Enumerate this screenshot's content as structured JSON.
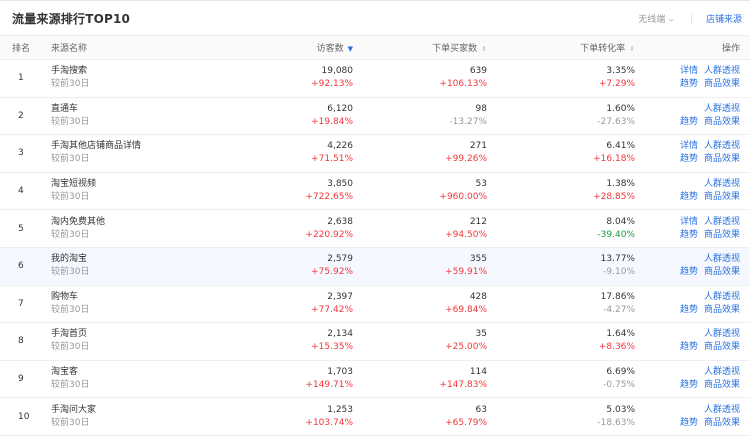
{
  "header": {
    "title": "流量来源排行TOP10",
    "wireless_label": "无线端",
    "shop_source_link": "店铺来源"
  },
  "columns": {
    "rank": "排名",
    "source_name": "来源名称",
    "visitors": "访客数",
    "buyers": "下单买家数",
    "conversion": "下单转化率",
    "operation": "操作"
  },
  "compare_label": "较前30日",
  "action_labels": {
    "detail": "详情",
    "crowd": "人群透视",
    "trend": "趋势",
    "product": "商品效果"
  },
  "colors": {
    "link": "#2b73e0",
    "increase": "#f2363a",
    "highlight_decrease": "#1a9c3a"
  },
  "rows": [
    {
      "rank": "1",
      "name": "手淘搜索",
      "visitors": "19,080",
      "visitors_change": "+92.13%",
      "buyers": "639",
      "buyers_change": "+106.13%",
      "conv": "3.35%",
      "conv_change": "+7.29%",
      "has_detail": true
    },
    {
      "rank": "2",
      "name": "直通车",
      "visitors": "6,120",
      "visitors_change": "+19.84%",
      "buyers": "98",
      "buyers_change": "-13.27%",
      "conv": "1.60%",
      "conv_change": "-27.63%",
      "has_detail": false
    },
    {
      "rank": "3",
      "name": "手淘其他店铺商品详情",
      "visitors": "4,226",
      "visitors_change": "+71.51%",
      "buyers": "271",
      "buyers_change": "+99.26%",
      "conv": "6.41%",
      "conv_change": "+16.18%",
      "has_detail": true
    },
    {
      "rank": "4",
      "name": "淘宝短视频",
      "visitors": "3,850",
      "visitors_change": "+722.65%",
      "buyers": "53",
      "buyers_change": "+960.00%",
      "conv": "1.38%",
      "conv_change": "+28.85%",
      "has_detail": false
    },
    {
      "rank": "5",
      "name": "淘内免费其他",
      "visitors": "2,638",
      "visitors_change": "+220.92%",
      "buyers": "212",
      "buyers_change": "+94.50%",
      "conv": "8.04%",
      "conv_change": "-39.40%",
      "has_detail": true
    },
    {
      "rank": "6",
      "name": "我的淘宝",
      "visitors": "2,579",
      "visitors_change": "+75.92%",
      "buyers": "355",
      "buyers_change": "+59.91%",
      "conv": "13.77%",
      "conv_change": "-9.10%",
      "has_detail": false
    },
    {
      "rank": "7",
      "name": "购物车",
      "visitors": "2,397",
      "visitors_change": "+77.42%",
      "buyers": "428",
      "buyers_change": "+69.84%",
      "conv": "17.86%",
      "conv_change": "-4.27%",
      "has_detail": false
    },
    {
      "rank": "8",
      "name": "手淘首页",
      "visitors": "2,134",
      "visitors_change": "+15.35%",
      "buyers": "35",
      "buyers_change": "+25.00%",
      "conv": "1.64%",
      "conv_change": "+8.36%",
      "has_detail": false
    },
    {
      "rank": "9",
      "name": "淘宝客",
      "visitors": "1,703",
      "visitors_change": "+149.71%",
      "buyers": "114",
      "buyers_change": "+147.83%",
      "conv": "6.69%",
      "conv_change": "-0.75%",
      "has_detail": false
    },
    {
      "rank": "10",
      "name": "手淘问大家",
      "visitors": "1,253",
      "visitors_change": "+103.74%",
      "buyers": "63",
      "buyers_change": "+65.79%",
      "conv": "5.03%",
      "conv_change": "-18.63%",
      "has_detail": false
    }
  ]
}
